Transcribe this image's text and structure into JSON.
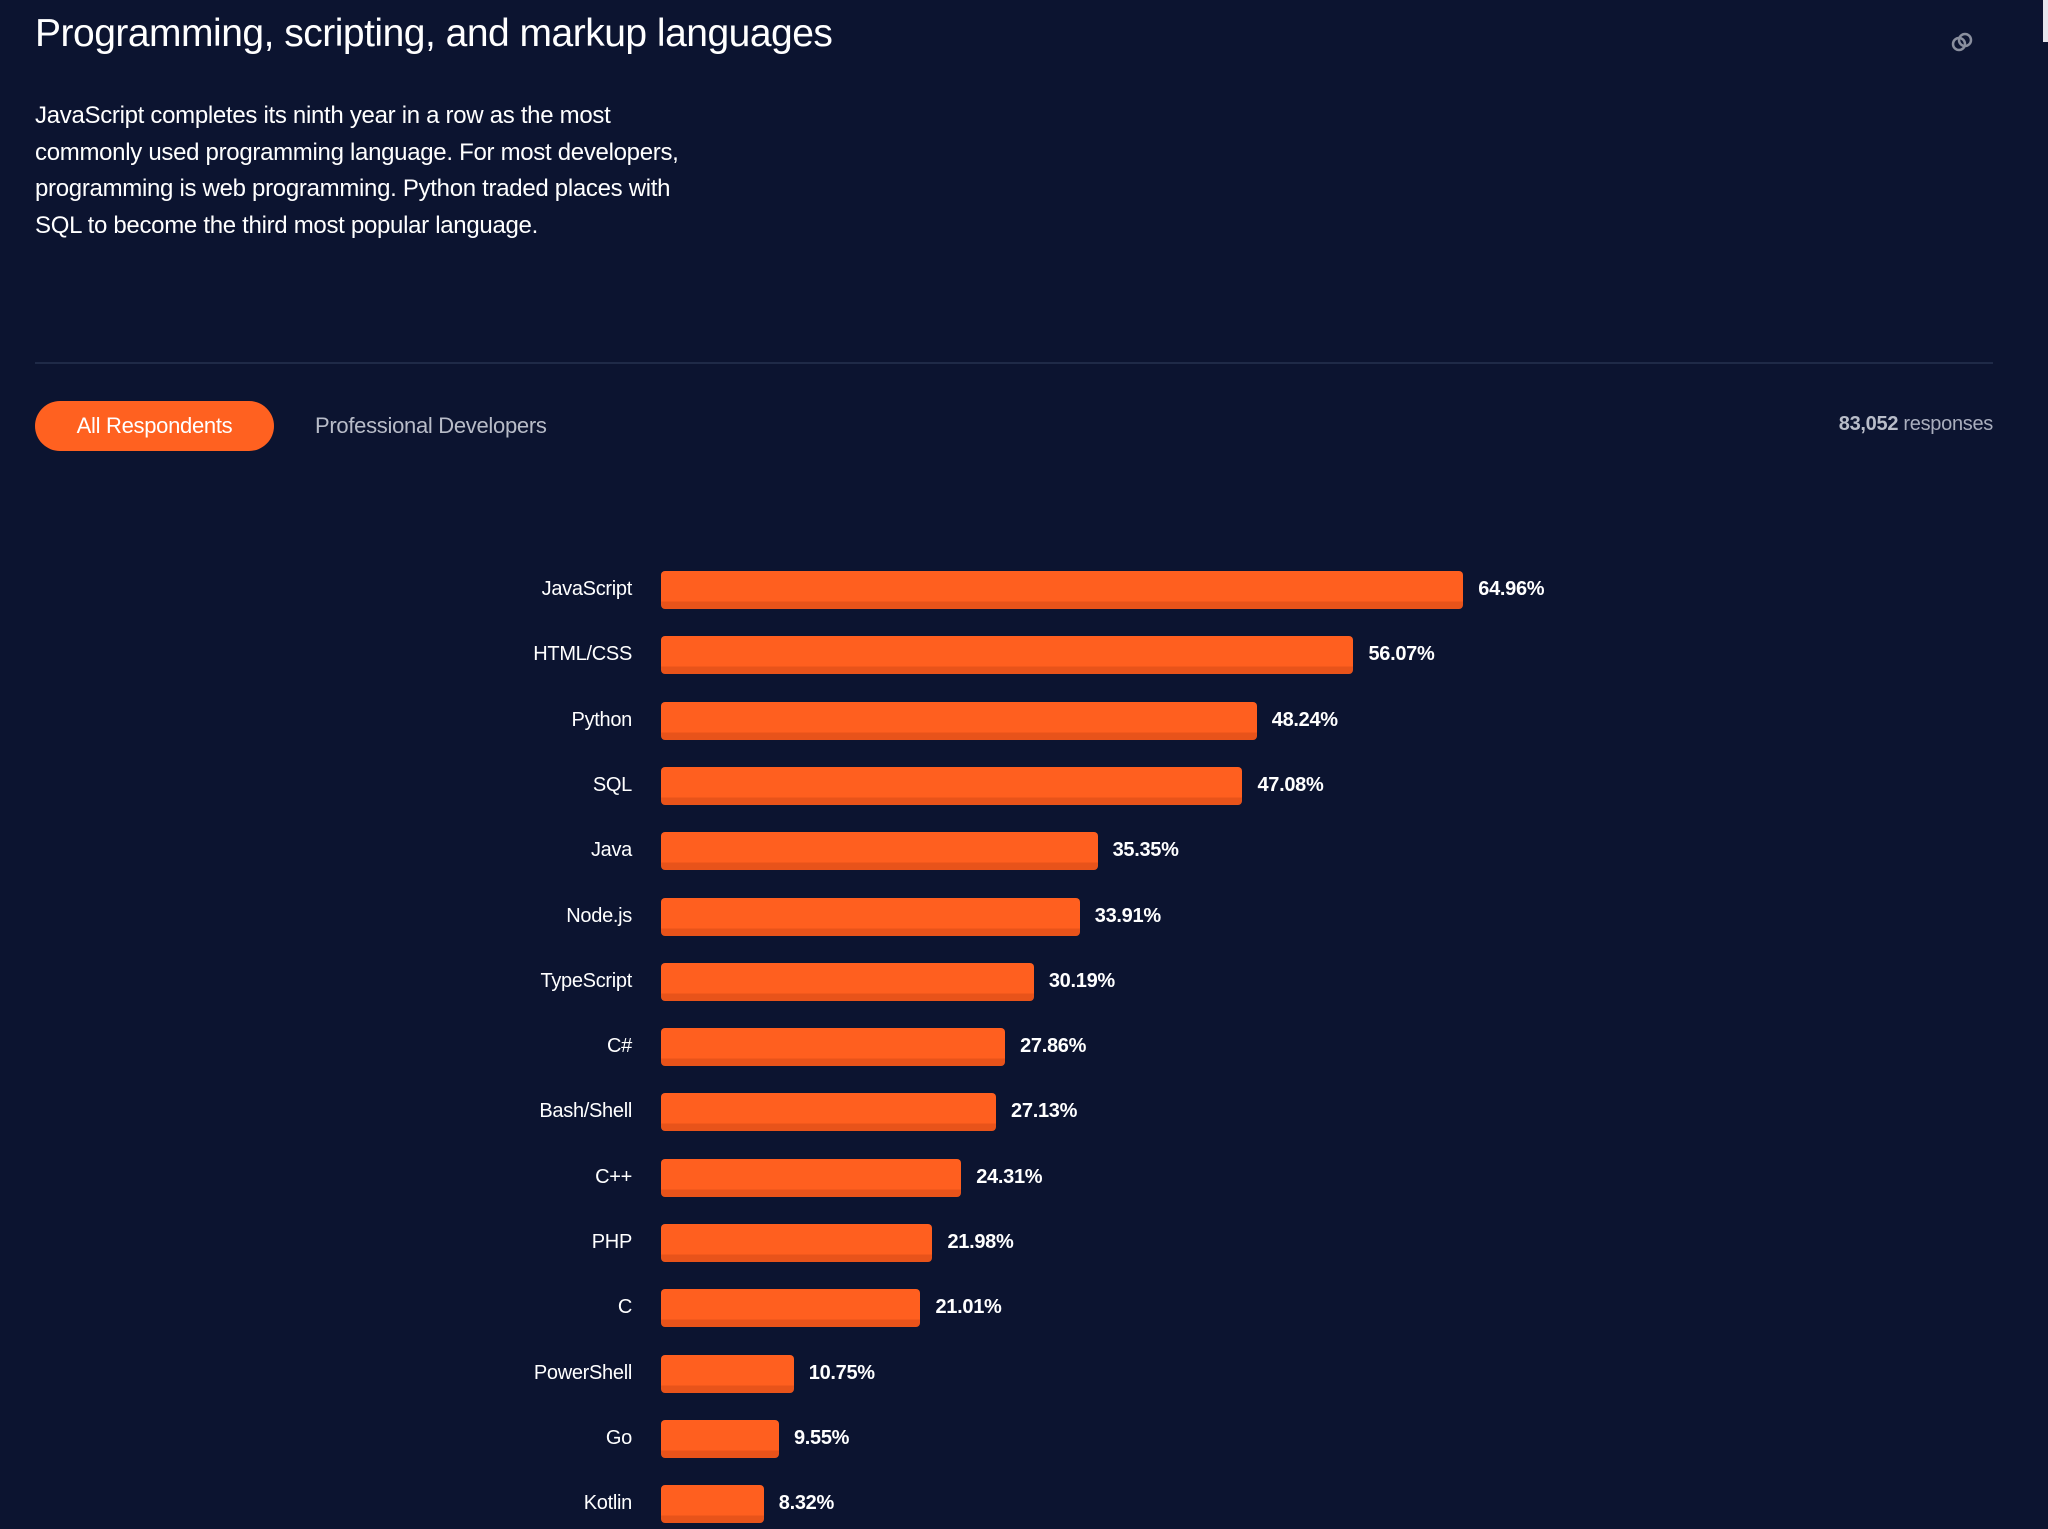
{
  "header": {
    "title": "Programming, scripting, and markup languages",
    "description": "JavaScript completes its ninth year in a row as the most commonly used programming language. For most developers, programming is web programming. Python traded places with SQL to become the third most popular language.",
    "link_icon": "link-icon"
  },
  "tabs": [
    {
      "label": "All Respondents",
      "active": true
    },
    {
      "label": "Professional Developers",
      "active": false
    }
  ],
  "responses": {
    "count": "83,052",
    "label": "responses"
  },
  "colors": {
    "background": "#0c1430",
    "accent": "#ff6120",
    "bar": "#ff5f1f"
  },
  "chart_data": {
    "type": "bar",
    "orientation": "horizontal",
    "title": "Programming, scripting, and markup languages",
    "xlabel": "",
    "ylabel": "",
    "unit": "%",
    "xlim": [
      0,
      100
    ],
    "grid": false,
    "categories": [
      "JavaScript",
      "HTML/CSS",
      "Python",
      "SQL",
      "Java",
      "Node.js",
      "TypeScript",
      "C#",
      "Bash/Shell",
      "C++",
      "PHP",
      "C",
      "PowerShell",
      "Go",
      "Kotlin"
    ],
    "values": [
      64.96,
      56.07,
      48.24,
      47.08,
      35.35,
      33.91,
      30.19,
      27.86,
      27.13,
      24.31,
      21.98,
      21.01,
      10.75,
      9.55,
      8.32
    ],
    "value_labels": [
      "64.96%",
      "56.07%",
      "48.24%",
      "47.08%",
      "35.35%",
      "33.91%",
      "30.19%",
      "27.86%",
      "27.13%",
      "24.31%",
      "21.98%",
      "21.01%",
      "10.75%",
      "9.55%",
      "8.32%"
    ]
  }
}
